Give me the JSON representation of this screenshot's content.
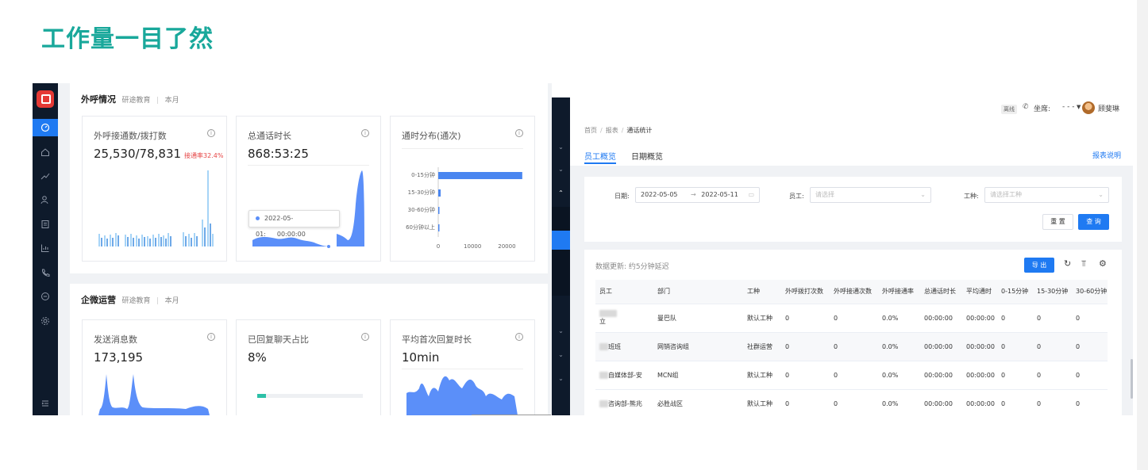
{
  "slide": {
    "title": "工作量一目了然"
  },
  "left": {
    "sidebar": {
      "items": [
        "dashboard-icon",
        "home-icon",
        "trend-icon",
        "users-icon",
        "report-icon",
        "chart-icon",
        "phone-icon",
        "chat-icon",
        "settings-icon",
        "collapse-icon"
      ]
    },
    "section1": {
      "title": "外呼情况",
      "org": "研途教育",
      "sep": "|",
      "range": "本月",
      "cards": [
        {
          "title": "外呼接通数/拨打数",
          "value": "25,530/78,831",
          "badge": "接通率32.4%"
        },
        {
          "title": "总通话时长",
          "value": "868:53:25",
          "tooltip_date": "2022-05-01:",
          "tooltip_time": "00:00:00"
        },
        {
          "title": "通时分布(通次)",
          "chart_data": {
            "type": "bar",
            "categories": [
              "0-15分钟",
              "15-30分钟",
              "30-60分钟",
              "60分钟以上"
            ],
            "values": [
              24500,
              700,
              300,
              50
            ],
            "xticks": [
              "0",
              "10000",
              "20000"
            ],
            "xlim": [
              0,
              25000
            ]
          }
        }
      ]
    },
    "section2": {
      "title": "企微运营",
      "org": "研途教育",
      "sep": "|",
      "range": "本月",
      "cards": [
        {
          "title": "发送消息数",
          "value": "173,195"
        },
        {
          "title": "已回复聊天占比",
          "value": "8%",
          "progress": 0.08
        },
        {
          "title": "平均首次回复时长",
          "value": "10min"
        }
      ]
    }
  },
  "right": {
    "topbar": {
      "status": "离线",
      "seat_label": "坐席:",
      "seat_value": "- - -",
      "user": "顾斐琳"
    },
    "breadcrumb": [
      "首页",
      "报表",
      "通话统计"
    ],
    "tabs": [
      "员工概览",
      "日期概览"
    ],
    "report_link": "报表说明",
    "filters": {
      "date_label": "日期:",
      "date_from": "2022-05-05",
      "date_arrow": "→",
      "date_to": "2022-05-11",
      "staff_label": "员工:",
      "staff_placeholder": "请选择",
      "type_label": "工种:",
      "type_placeholder": "请选择工种",
      "reset": "重 置",
      "query": "查 询"
    },
    "table": {
      "update_text": "数据更新: 约5分钟延迟",
      "export": "导 出",
      "columns": [
        "员工",
        "部门",
        "工种",
        "外呼拨打次数",
        "外呼接通次数",
        "外呼接通率",
        "总通话时长",
        "平均通时",
        "0-15分钟",
        "15-30分钟",
        "30-60分钟"
      ],
      "rows": [
        {
          "name": "立",
          "dept": "曼巴队",
          "type": "默认工种",
          "dial": "0",
          "conn": "0",
          "rate": "0.0%",
          "total": "00:00:00",
          "avg": "00:00:00",
          "b1": "0",
          "b2": "0",
          "b3": "0"
        },
        {
          "name": "班班",
          "dept": "网销咨询组",
          "type": "社群运营",
          "dial": "0",
          "conn": "0",
          "rate": "0.0%",
          "total": "00:00:00",
          "avg": "00:00:00",
          "b1": "0",
          "b2": "0",
          "b3": "0"
        },
        {
          "name": "自媒体部-安",
          "dept": "MCN组",
          "type": "默认工种",
          "dial": "0",
          "conn": "0",
          "rate": "0.0%",
          "total": "00:00:00",
          "avg": "00:00:00",
          "b1": "0",
          "b2": "0",
          "b3": "0"
        },
        {
          "name": "咨询部-熊兆",
          "dept": "必胜战区",
          "type": "默认工种",
          "dial": "0",
          "conn": "0",
          "rate": "0.0%",
          "total": "00:00:00",
          "avg": "00:00:00",
          "b1": "0",
          "b2": "0",
          "b3": "0"
        }
      ]
    }
  }
}
